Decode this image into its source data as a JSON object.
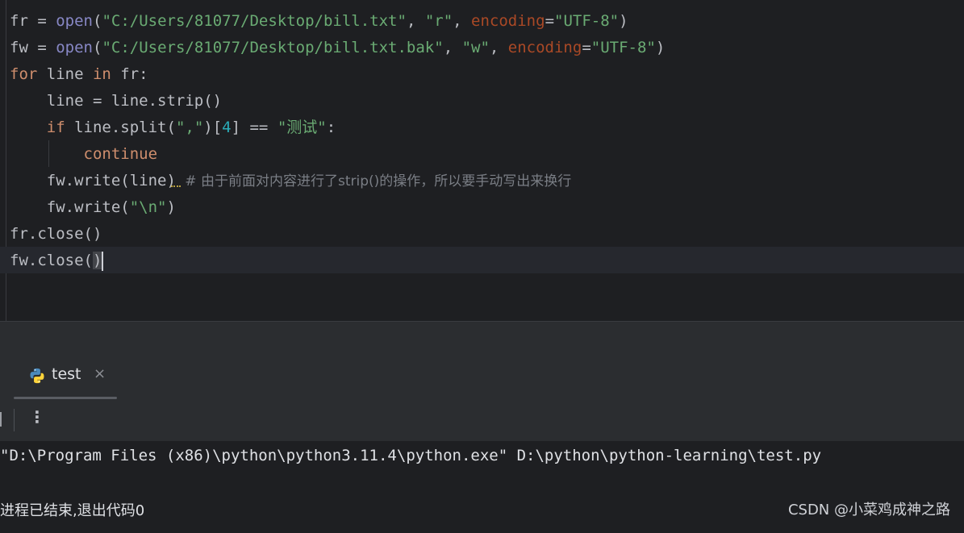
{
  "editor": {
    "lines": [
      {
        "t1": "fr",
        "t2": " = ",
        "t3": "open",
        "t4": "(",
        "t5": "\"C:/Users/81077/Desktop/bill.txt\"",
        "t6": ", ",
        "t7": "\"r\"",
        "t8": ", ",
        "t9": "encoding",
        "t10": "=",
        "t11": "\"UTF-8\"",
        "t12": ")"
      },
      {
        "t1": "fw",
        "t2": " = ",
        "t3": "open",
        "t4": "(",
        "t5": "\"C:/Users/81077/Desktop/bill.txt.bak\"",
        "t6": ", ",
        "t7": "\"w\"",
        "t8": ", ",
        "t9": "encoding",
        "t10": "=",
        "t11": "\"UTF-8\"",
        "t12": ")"
      }
    ],
    "line3": {
      "kw1": "for",
      "v1": " line ",
      "kw2": "in",
      "v2": " fr:"
    },
    "line4": {
      "text": "    line = line.strip()"
    },
    "line5": {
      "indent": "    ",
      "kw": "if",
      "a": " line.split(",
      "s1": "\",\"",
      "b": ")[",
      "num": "4",
      "c": "] == ",
      "s2": "\"测试\"",
      "d": ":"
    },
    "line6": {
      "indent": "        ",
      "kw": "continue"
    },
    "line7": {
      "code": "    fw.write(line)",
      "comment": " # 由于前面对内容进行了strip()的操作，所以要手动写出来换行"
    },
    "line8": {
      "a": "    fw.write(",
      "s": "\"\\n\"",
      "b": ")"
    },
    "line9": {
      "text": "fr.close()"
    },
    "line10": {
      "a": "fw.close(",
      "b": ")"
    }
  },
  "run_panel": {
    "tab_label": "test",
    "tab_close": "×",
    "more_icon": "⋮",
    "console_command": "\"D:\\Program Files (x86)\\python\\python3.11.4\\python.exe\" D:\\python\\python-learning\\test.py",
    "console_exit": "进程已结束,退出代码0"
  },
  "watermark": "CSDN @小菜鸡成神之路",
  "icons": {
    "tab_icon": "python-icon",
    "close": "close-icon",
    "more": "more-vertical-icon"
  },
  "colors": {
    "keyword": "#cf8e6d",
    "string": "#6aab73",
    "param": "#aa4926",
    "number": "#2aacb8",
    "builtin": "#8888c6",
    "comment": "#7a7e85"
  }
}
